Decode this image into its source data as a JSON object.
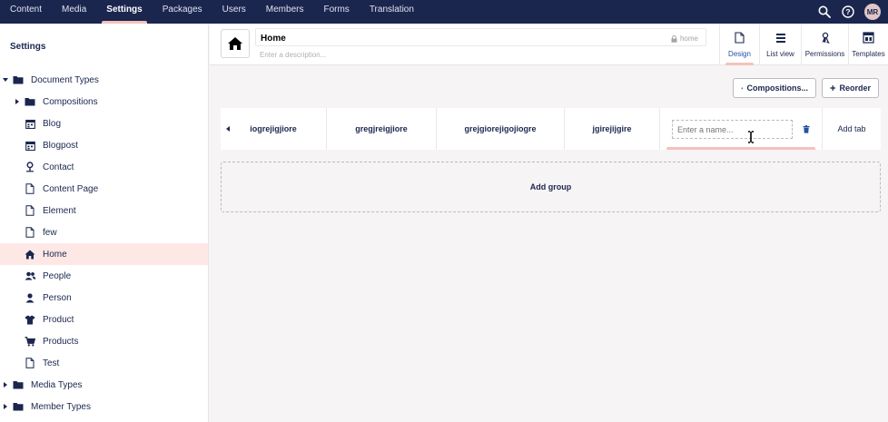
{
  "nav": {
    "items": [
      {
        "label": "Content"
      },
      {
        "label": "Media"
      },
      {
        "label": "Settings",
        "active": true
      },
      {
        "label": "Packages"
      },
      {
        "label": "Users"
      },
      {
        "label": "Members"
      },
      {
        "label": "Forms"
      },
      {
        "label": "Translation"
      }
    ],
    "avatar_initials": "MR"
  },
  "sidebar": {
    "title": "Settings",
    "items": [
      {
        "label": "Document Types",
        "icon": "folder-icon",
        "level": 0,
        "caret": "down"
      },
      {
        "label": "Compositions",
        "icon": "folder-icon",
        "level": 1,
        "caret": "right"
      },
      {
        "label": "Blog",
        "icon": "calendar-icon",
        "level": 1
      },
      {
        "label": "Blogpost",
        "icon": "calendar-icon",
        "level": 1
      },
      {
        "label": "Contact",
        "icon": "map-pin-icon",
        "level": 1
      },
      {
        "label": "Content Page",
        "icon": "document-icon",
        "level": 1
      },
      {
        "label": "Element",
        "icon": "document-icon",
        "level": 1
      },
      {
        "label": "few",
        "icon": "document-icon",
        "level": 1
      },
      {
        "label": "Home",
        "icon": "home-icon",
        "level": 1,
        "selected": true
      },
      {
        "label": "People",
        "icon": "users-icon",
        "level": 1
      },
      {
        "label": "Person",
        "icon": "user-icon",
        "level": 1
      },
      {
        "label": "Product",
        "icon": "shirt-icon",
        "level": 1
      },
      {
        "label": "Products",
        "icon": "cart-icon",
        "level": 1
      },
      {
        "label": "Test",
        "icon": "document-icon",
        "level": 1
      },
      {
        "label": "Media Types",
        "icon": "folder-icon",
        "level": 0,
        "caret": "right"
      },
      {
        "label": "Member Types",
        "icon": "folder-icon",
        "level": 0,
        "caret": "right"
      }
    ]
  },
  "header": {
    "name": "Home",
    "alias": "home",
    "description_placeholder": "Enter a description...",
    "tabs": [
      {
        "label": "Design",
        "icon": "document-icon",
        "active": true
      },
      {
        "label": "List view",
        "icon": "list-icon"
      },
      {
        "label": "Permissions",
        "icon": "permissions-icon"
      },
      {
        "label": "Templates",
        "icon": "templates-icon"
      }
    ]
  },
  "toolbar": {
    "compositions_label": "Compositions...",
    "reorder_label": "Reorder"
  },
  "group_tabs": [
    {
      "label": "iogrejigjiore"
    },
    {
      "label": "gregjreigjiore"
    },
    {
      "label": "grejgiorejigojiogre"
    },
    {
      "label": "jgirejijgire"
    }
  ],
  "new_tab": {
    "placeholder": "Enter a name..."
  },
  "add_tab_label": "Add tab",
  "add_group_label": "Add group"
}
